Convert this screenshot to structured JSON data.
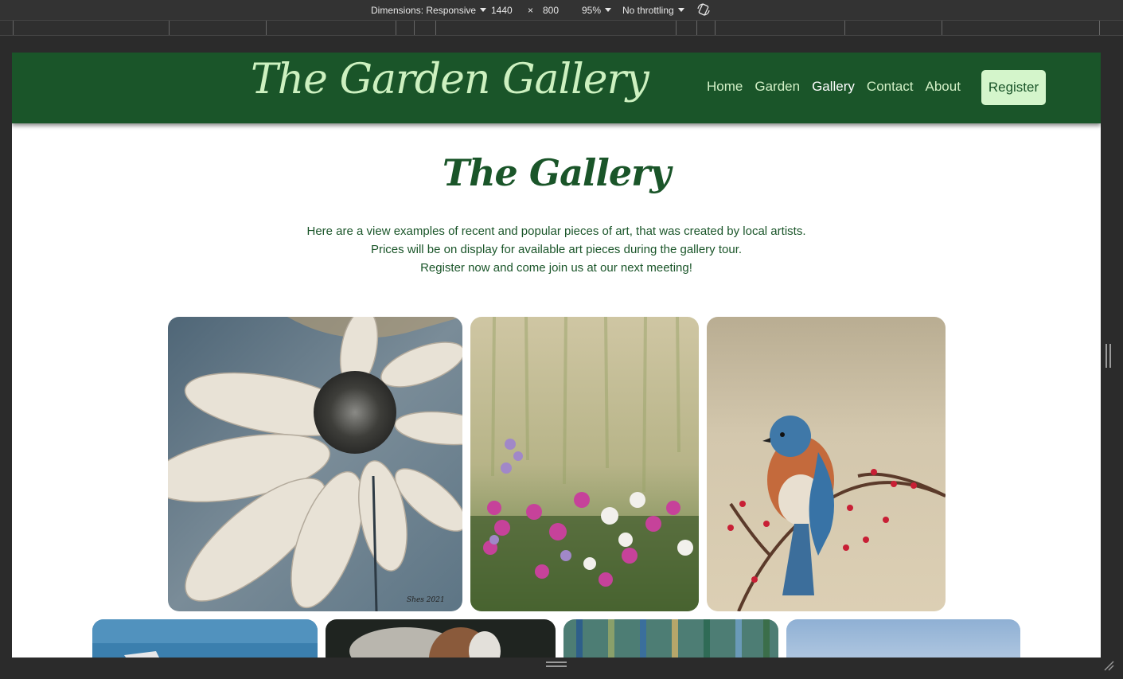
{
  "devtools": {
    "dimensions_label": "Dimensions: Responsive",
    "width": "1440",
    "times": "×",
    "height": "800",
    "zoom": "95%",
    "throttling": "No throttling",
    "rotate_icon": "rotate-icon"
  },
  "header": {
    "logo": "The Garden Gallery",
    "nav": [
      "Home",
      "Garden",
      "Gallery",
      "Contact",
      "About"
    ],
    "active_nav": "Gallery",
    "register": "Register"
  },
  "main": {
    "title": "The Gallery",
    "intro_lines": [
      "Here are a view examples of recent and popular pieces of art, that was created by local artists.",
      "Prices will be on display for available art pieces during the gallery tour.",
      "Register now and come join us at our next meeting!"
    ],
    "artworks": [
      {
        "subject": "white daisy painting"
      },
      {
        "subject": "wildflower meadow painting"
      },
      {
        "subject": "bluebird on branch painting"
      },
      {
        "subject": "sailboat painting"
      },
      {
        "subject": "child with hat painting"
      },
      {
        "subject": "abstract reflection painting"
      },
      {
        "subject": "blue sky painting"
      }
    ]
  },
  "colors": {
    "header_bg": "#1a5529",
    "logo": "#cdf1c0",
    "button_bg": "#d4f5cb",
    "text": "#1a5529"
  }
}
